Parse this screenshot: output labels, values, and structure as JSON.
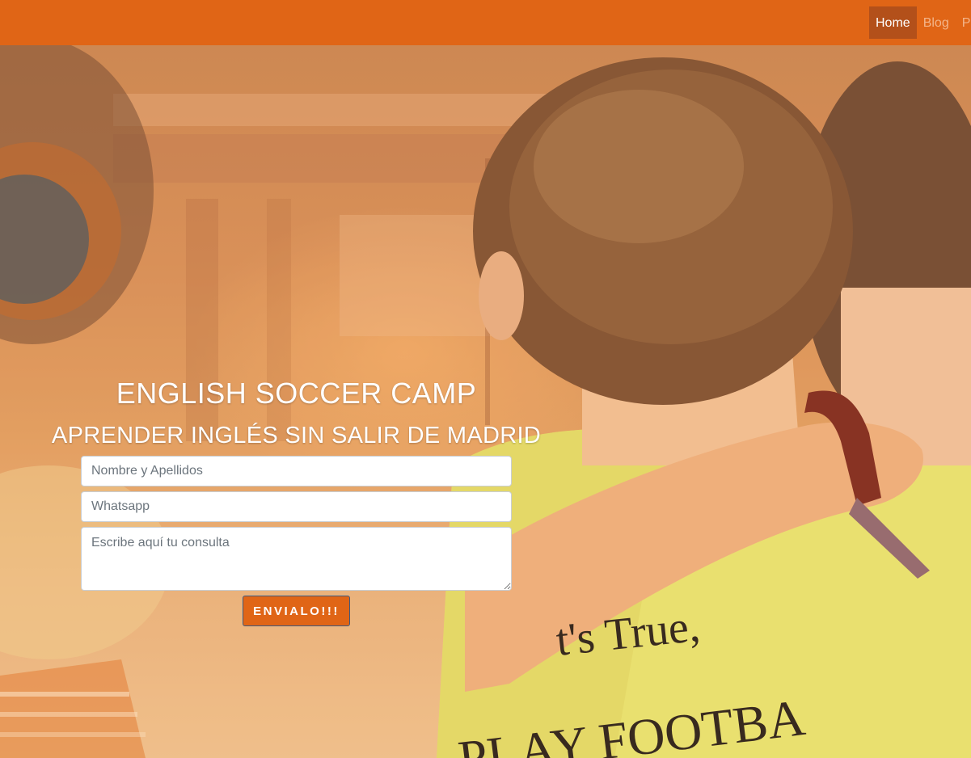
{
  "nav": {
    "items": [
      {
        "label": "Home",
        "active": true
      },
      {
        "label": "Blog",
        "active": false
      },
      {
        "label": "P",
        "active": false
      }
    ]
  },
  "hero": {
    "title": "ENGLISH SOCCER CAMP",
    "subtitle": "APRENDER INGLÉS SIN SALIR DE MADRID",
    "background_image": "photo-kids-soccer-shirts",
    "shirt_text_line1": "t's True,",
    "shirt_text_line2": "PLAY FOOTBA"
  },
  "form": {
    "name_placeholder": "Nombre y Apellidos",
    "name_value": "",
    "whatsapp_placeholder": "Whatsapp",
    "whatsapp_value": "",
    "message_placeholder": "Escribe aquí tu consulta",
    "message_value": "",
    "submit_label": "ENVIALO!!!"
  },
  "colors": {
    "brand_orange": "#e06516",
    "nav_active_bg": "#b3501a",
    "nav_inactive_text": "#f3b58a"
  }
}
